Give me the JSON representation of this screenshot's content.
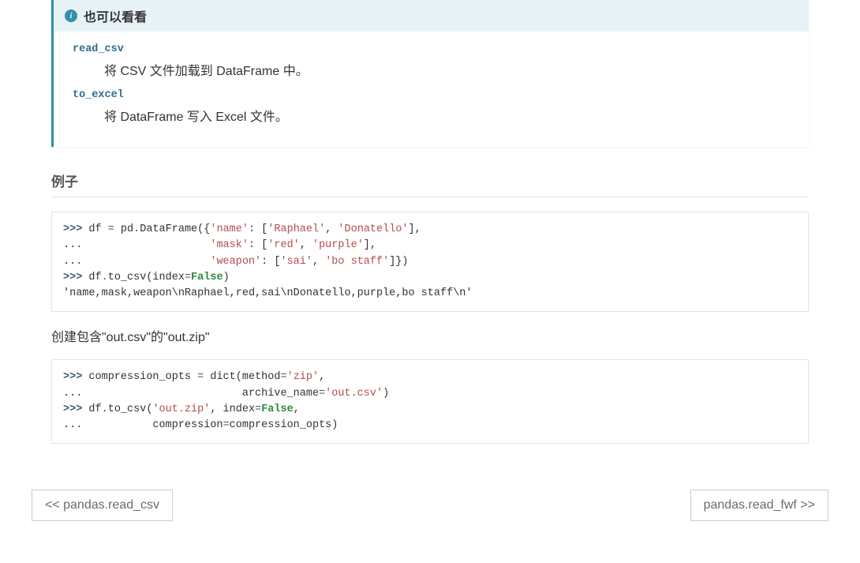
{
  "seealso": {
    "title": "也可以看看",
    "items": [
      {
        "term": "read_csv",
        "desc": "将 CSV 文件加载到 DataFrame 中。"
      },
      {
        "term": "to_excel",
        "desc": "将 DataFrame 写入 Excel 文件。"
      }
    ]
  },
  "examples": {
    "heading": "例子",
    "block1": {
      "l1_prompt": ">>> ",
      "l1_code_a": "df ",
      "l1_op": "=",
      "l1_code_b": " pd",
      "l1_dot": ".",
      "l1_code_c": "DataFrame({",
      "l1_s1": "'name'",
      "l1_code_d": ": [",
      "l1_s2": "'Raphael'",
      "l1_code_e": ", ",
      "l1_s3": "'Donatello'",
      "l1_code_f": "],",
      "l2_prompt": "... ",
      "l2_pad": "                   ",
      "l2_s1": "'mask'",
      "l2_code_a": ": [",
      "l2_s2": "'red'",
      "l2_code_b": ", ",
      "l2_s3": "'purple'",
      "l2_code_c": "],",
      "l3_prompt": "... ",
      "l3_pad": "                   ",
      "l3_s1": "'weapon'",
      "l3_code_a": ": [",
      "l3_s2": "'sai'",
      "l3_code_b": ", ",
      "l3_s3": "'bo staff'",
      "l3_code_c": "]})",
      "l4_prompt": ">>> ",
      "l4_code_a": "df",
      "l4_dot": ".",
      "l4_code_b": "to_csv(index",
      "l4_op": "=",
      "l4_kw": "False",
      "l4_code_c": ")",
      "l5_out": "'name,mask,weapon\\nRaphael,red,sai\\nDonatello,purple,bo staff\\n'"
    },
    "para1": "创建包含\"out.csv\"的\"out.zip\"",
    "block2": {
      "l1_prompt": ">>> ",
      "l1_code_a": "compression_opts ",
      "l1_op": "=",
      "l1_code_b": " ",
      "l1_func": "dict",
      "l1_code_c": "(method",
      "l1_op2": "=",
      "l1_s1": "'zip'",
      "l1_code_d": ",",
      "l2_prompt": "... ",
      "l2_pad": "                        archive_name",
      "l2_op": "=",
      "l2_s1": "'out.csv'",
      "l2_code_a": ")",
      "l3_prompt": ">>> ",
      "l3_code_a": "df",
      "l3_dot": ".",
      "l3_code_b": "to_csv(",
      "l3_s1": "'out.zip'",
      "l3_code_c": ", index",
      "l3_op": "=",
      "l3_kw": "False",
      "l3_code_d": ",",
      "l4_prompt": "... ",
      "l4_pad": "          compression",
      "l4_op": "=",
      "l4_code_a": "compression_opts)"
    }
  },
  "nav": {
    "prev": "<< pandas.read_csv",
    "next": "pandas.read_fwf >>"
  }
}
